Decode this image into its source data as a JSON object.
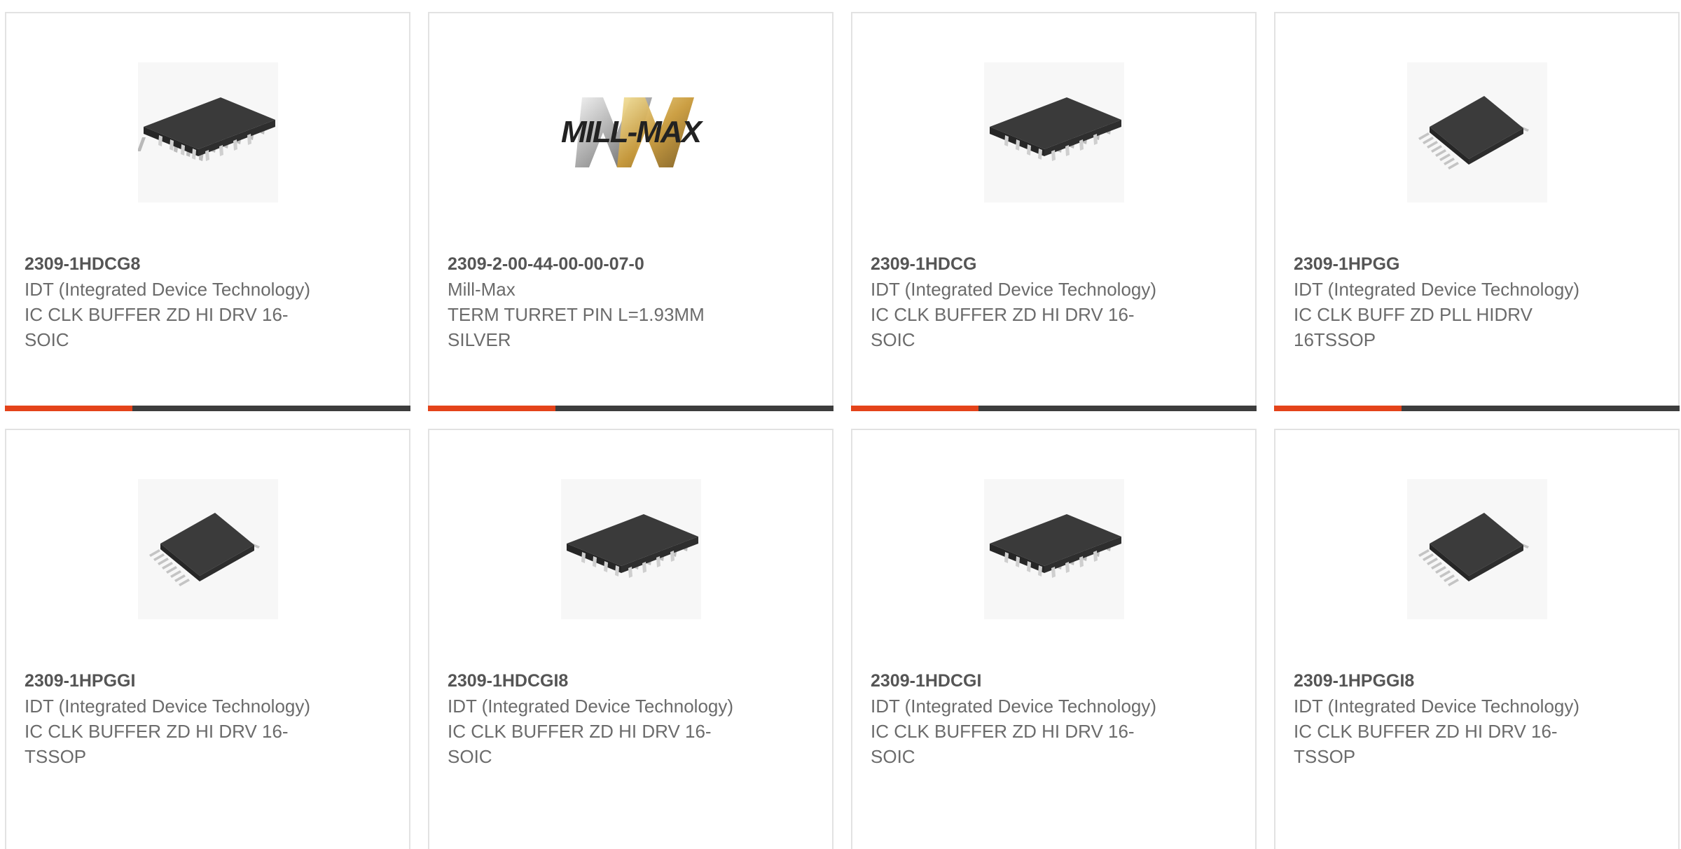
{
  "products": [
    {
      "part_number": "2309-1HDCG8",
      "manufacturer": "IDT (Integrated Device Technology)",
      "description": "IC CLK BUFFER ZD HI DRV 16-SOIC",
      "image": "soic-chip-icon",
      "progress": 0.315
    },
    {
      "part_number": "2309-2-00-44-00-00-07-0",
      "manufacturer": "Mill-Max",
      "description": "TERM TURRET PIN L=1.93MM SILVER",
      "image": "mill-max-logo",
      "logo_text": "MILL-MAX",
      "progress": 0.315
    },
    {
      "part_number": "2309-1HDCG",
      "manufacturer": "IDT (Integrated Device Technology)",
      "description": "IC CLK BUFFER ZD HI DRV 16-SOIC",
      "image": "soic-chip-icon",
      "progress": 0.315
    },
    {
      "part_number": "2309-1HPGG",
      "manufacturer": "IDT (Integrated Device Technology)",
      "description": "IC CLK BUFF ZD PLL HIDRV 16TSSOP",
      "image": "tssop-chip-icon",
      "progress": 0.315
    },
    {
      "part_number": "2309-1HPGGI",
      "manufacturer": "IDT (Integrated Device Technology)",
      "description": "IC CLK BUFFER ZD HI DRV 16-TSSOP",
      "image": "tssop-chip-icon"
    },
    {
      "part_number": "2309-1HDCGI8",
      "manufacturer": "IDT (Integrated Device Technology)",
      "description": "IC CLK BUFFER ZD HI DRV 16-SOIC",
      "image": "soic-chip-icon"
    },
    {
      "part_number": "2309-1HDCGI",
      "manufacturer": "IDT (Integrated Device Technology)",
      "description": "IC CLK BUFFER ZD HI DRV 16-SOIC",
      "image": "soic-chip-icon"
    },
    {
      "part_number": "2309-1HPGGI8",
      "manufacturer": "IDT (Integrated Device Technology)",
      "description": "IC CLK BUFFER ZD HI DRV 16-TSSOP",
      "image": "tssop-chip-icon"
    }
  ],
  "colors": {
    "accent": "#e4431a",
    "bar": "#3d3d3d",
    "border": "#e2e2e2",
    "part_number": "#555555",
    "text": "#6b6b6b"
  }
}
